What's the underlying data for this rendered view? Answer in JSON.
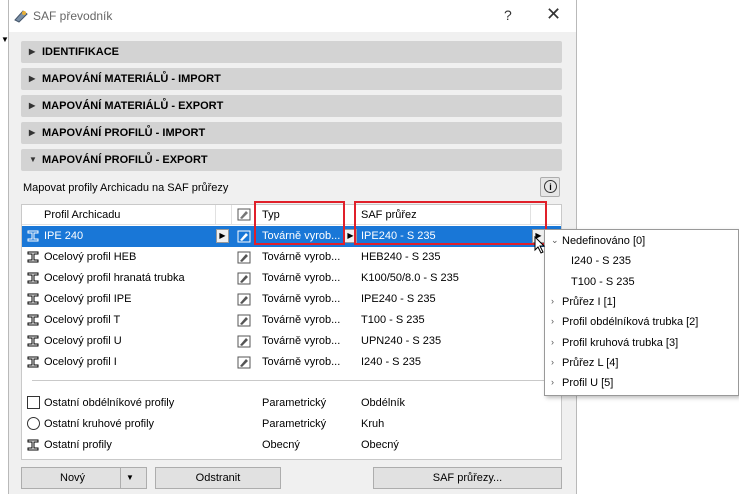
{
  "window": {
    "title": "SAF převodník",
    "help": "?",
    "close": "✕"
  },
  "sections": [
    {
      "label": "IDENTIFIKACE",
      "expanded": false
    },
    {
      "label": "MAPOVÁNÍ MATERIÁLŮ - IMPORT",
      "expanded": false
    },
    {
      "label": "MAPOVÁNÍ MATERIÁLŮ - EXPORT",
      "expanded": false
    },
    {
      "label": "MAPOVÁNÍ PROFILŮ - IMPORT",
      "expanded": false
    },
    {
      "label": "MAPOVÁNÍ PROFILŮ - EXPORT",
      "expanded": true
    }
  ],
  "mapping": {
    "caption": "Mapovat profily Archicadu na SAF průřezy",
    "info_icon": "i",
    "columns": {
      "profile": "Profil Archicadu",
      "type": "Typ",
      "saf": "SAF průřez"
    },
    "rows": [
      {
        "icon": "i-beam-icon",
        "profile": "IPE 240",
        "type": "Továrně vyrob...",
        "saf": "IPE240 - S 235",
        "selected": true
      },
      {
        "icon": "i-beam-icon",
        "profile": "Ocelový profil HEB",
        "type": "Továrně vyrob...",
        "saf": "HEB240 - S 235"
      },
      {
        "icon": "i-beam-icon",
        "profile": "Ocelový profil hranatá trubka",
        "type": "Továrně vyrob...",
        "saf": "K100/50/8.0 - S 235"
      },
      {
        "icon": "i-beam-icon",
        "profile": "Ocelový profil IPE",
        "type": "Továrně vyrob...",
        "saf": "IPE240 - S 235"
      },
      {
        "icon": "i-beam-icon",
        "profile": "Ocelový profil T",
        "type": "Továrně vyrob...",
        "saf": "T100 - S 235"
      },
      {
        "icon": "i-beam-icon",
        "profile": "Ocelový profil U",
        "type": "Továrně vyrob...",
        "saf": "UPN240 - S 235"
      },
      {
        "icon": "i-beam-icon",
        "profile": "Ocelový profil I",
        "type": "Továrně vyrob...",
        "saf": "I240 - S 235"
      }
    ],
    "other_rows": [
      {
        "icon": "checkbox-icon",
        "profile": "Ostatní obdélníkové profily",
        "type": "Parametrický",
        "saf": "Obdélník"
      },
      {
        "icon": "radio-icon",
        "profile": "Ostatní kruhové profily",
        "type": "Parametrický",
        "saf": "Kruh"
      },
      {
        "icon": "i-beam-icon",
        "profile": "Ostatní profily",
        "type": "Obecný",
        "saf": "Obecný"
      }
    ]
  },
  "buttons": {
    "new": "Nový",
    "new_arrow": "▼",
    "remove": "Odstranit",
    "saf": "SAF průřezy..."
  },
  "dropdown": {
    "items": [
      {
        "label": "Nedefinováno [0]",
        "level": 0,
        "expanded": true
      },
      {
        "label": "I240 - S 235",
        "level": 1
      },
      {
        "label": "T100 - S 235",
        "level": 1
      },
      {
        "label": "Průřez I [1]",
        "level": 0,
        "expanded": false
      },
      {
        "label": "Profil obdélníková trubka [2]",
        "level": 0,
        "expanded": false
      },
      {
        "label": "Profil kruhová trubka [3]",
        "level": 0,
        "expanded": false
      },
      {
        "label": "Průřez L [4]",
        "level": 0,
        "expanded": false
      },
      {
        "label": "Profil U [5]",
        "level": 0,
        "expanded": false
      }
    ]
  },
  "colors": {
    "selection": "#1977d7",
    "highlight_box": "#e0202a",
    "section_bg": "#d3d3d3"
  }
}
